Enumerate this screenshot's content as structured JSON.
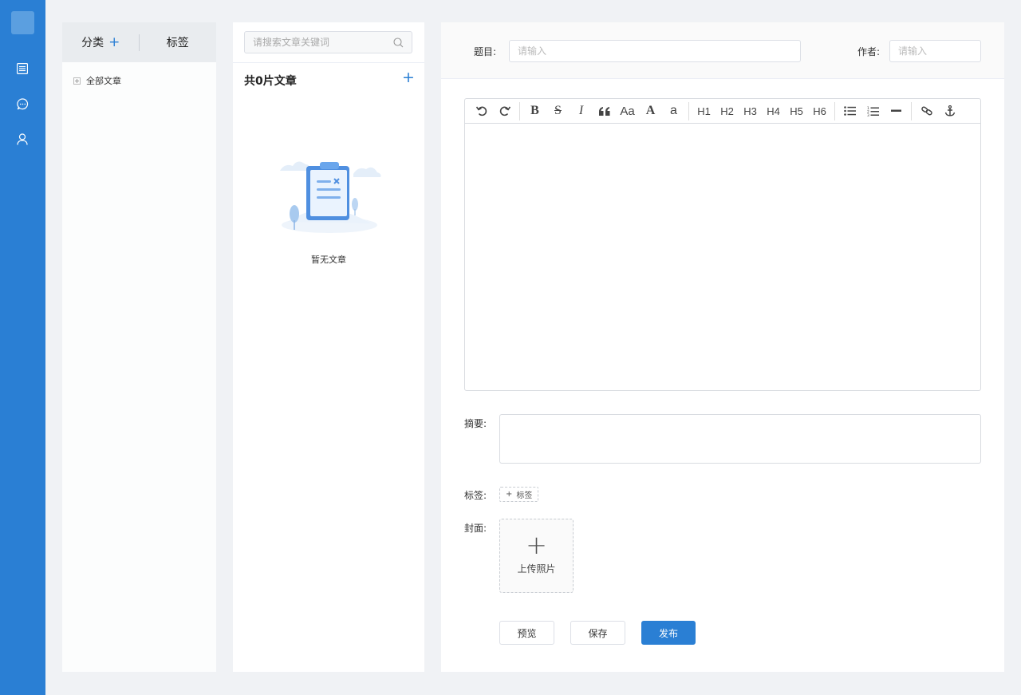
{
  "categories_panel": {
    "tab_category": "分类",
    "tab_tags": "标签",
    "tree": [
      {
        "label": "全部文章"
      }
    ]
  },
  "list_panel": {
    "search_placeholder": "请搜索文章关键词",
    "count_label": "共0片文章",
    "empty_text": "暂无文章"
  },
  "editor_panel": {
    "title_label": "题目:",
    "title_placeholder": "请输入",
    "author_label": "作者:",
    "author_placeholder": "请输入",
    "toolbar": {
      "headings": [
        "H1",
        "H2",
        "H3",
        "H4",
        "H5",
        "H6"
      ],
      "font_size_label": "Aa",
      "font_a_label": "A",
      "font_small_a_label": "a",
      "bold_label": "B",
      "strike_label": "S",
      "italic_label": "I"
    },
    "abstract_label": "摘要:",
    "tags_label": "标签:",
    "tag_add_label": "标签",
    "cover_label": "封面:",
    "upload_label": "上传照片",
    "buttons": {
      "preview": "预览",
      "save": "保存",
      "publish": "发布"
    }
  },
  "colors": {
    "accent": "#2a7fd4",
    "rail": "#2a7fd4",
    "background": "#f0f2f5"
  }
}
